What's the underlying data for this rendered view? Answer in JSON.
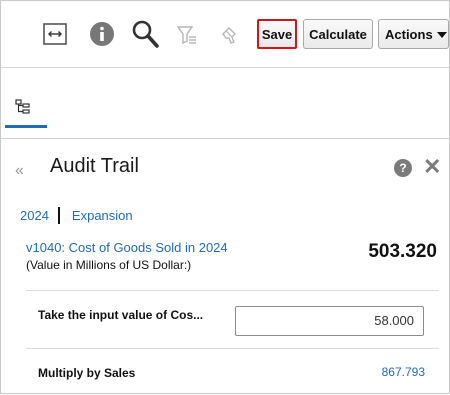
{
  "toolbar": {
    "icons": [
      "collapse-panel-icon",
      "info-icon",
      "search-icon",
      "filter-icon",
      "brush-icon"
    ],
    "save_label": "Save",
    "calculate_label": "Calculate",
    "actions_label": "Actions"
  },
  "panel": {
    "title": "Audit Trail",
    "breadcrumbs": [
      "2024",
      "Expansion"
    ],
    "account_link": "v1040: Cost of Goods Sold in 2024",
    "account_sub": "(Value in Millions of US Dollar:)",
    "account_value": "503.320",
    "rows": [
      {
        "label": "Take the input value of Cos...",
        "value": "58.000"
      },
      {
        "label": "Multiply by Sales",
        "value": "867.793"
      }
    ]
  },
  "colors": {
    "link": "#1e6bb8",
    "save_border": "#d4151c",
    "tab_indicator": "#1e6bb8",
    "icon_gray": "#7b7b7b"
  }
}
